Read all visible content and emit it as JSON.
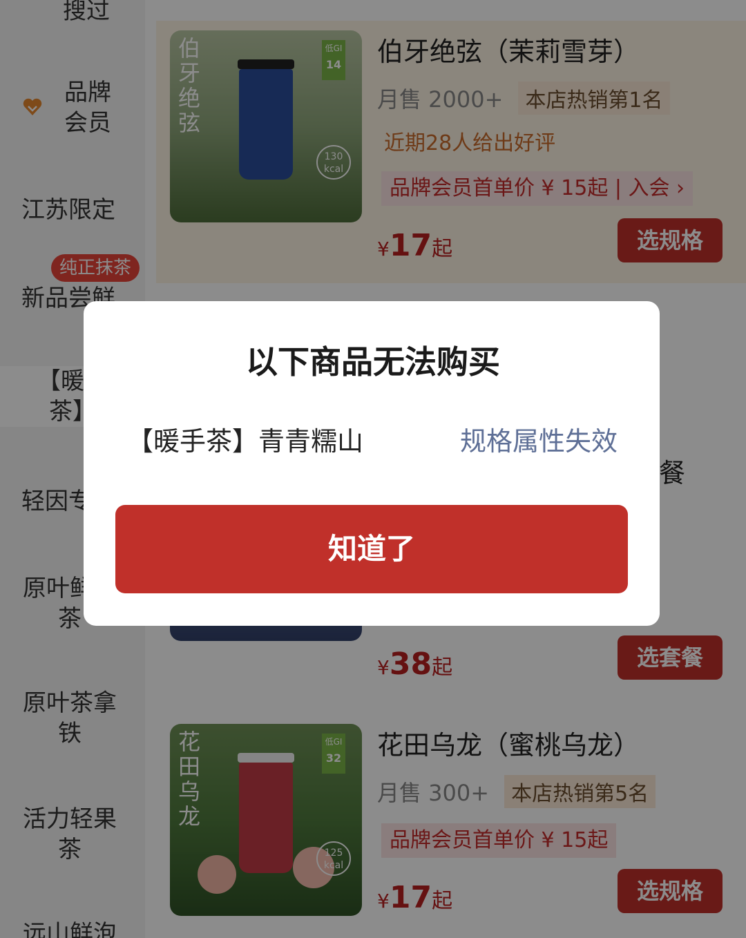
{
  "sidebar": {
    "items": [
      {
        "label": "搜过"
      },
      {
        "label": "品牌\n会员"
      },
      {
        "label": "江苏限定"
      },
      {
        "label": "新品尝鲜",
        "badge": "纯正抹茶"
      },
      {
        "label": "【暖手\n茶】"
      },
      {
        "label": "轻因专区"
      },
      {
        "label": "原叶鲜奶\n茶"
      },
      {
        "label": "原叶茶拿\n铁"
      },
      {
        "label": "活力轻果\n茶"
      },
      {
        "label": "远山鲜泡"
      }
    ],
    "heart_icon": "heart-icon"
  },
  "products": [
    {
      "name": "伯牙绝弦（茉莉雪芽）",
      "image_text": "伯牙绝弦",
      "gi_label": "低GI",
      "gi_value": "14",
      "kcal_value": "130",
      "kcal_unit": "kcal",
      "sales": "月售 2000+",
      "rank": "本店热销第1名",
      "review": "近期28人给出好评",
      "member": "品牌会员首单价 ¥ 15起 | 入会 ›",
      "price_currency": "¥",
      "price": "17",
      "price_suffix": "起",
      "button": "选规格",
      "cup_color": "#2b4d9b"
    },
    {
      "name_tail": "餐",
      "price_currency": "¥",
      "price": "38",
      "price_suffix": "起",
      "button": "选套餐"
    },
    {
      "name": "花田乌龙（蜜桃乌龙）",
      "image_text": "花田乌龙",
      "gi_label": "低GI",
      "gi_value": "32",
      "kcal_value": "125",
      "kcal_unit": "kcal",
      "sales": "月售 300+",
      "rank": "本店热销第5名",
      "member": "品牌会员首单价 ¥ 15起",
      "price_currency": "¥",
      "price": "17",
      "price_suffix": "起",
      "button": "选规格",
      "cup_color": "#c23b45"
    }
  ],
  "modal": {
    "title": "以下商品无法购买",
    "item_name": "【暖手茶】青青糯山",
    "item_reason": "规格属性失效",
    "confirm_button": "知道了"
  },
  "colors": {
    "accent_red": "#c0302a",
    "reason_blue": "#5e6f96",
    "highlight_bg": "#fdf4e4"
  }
}
